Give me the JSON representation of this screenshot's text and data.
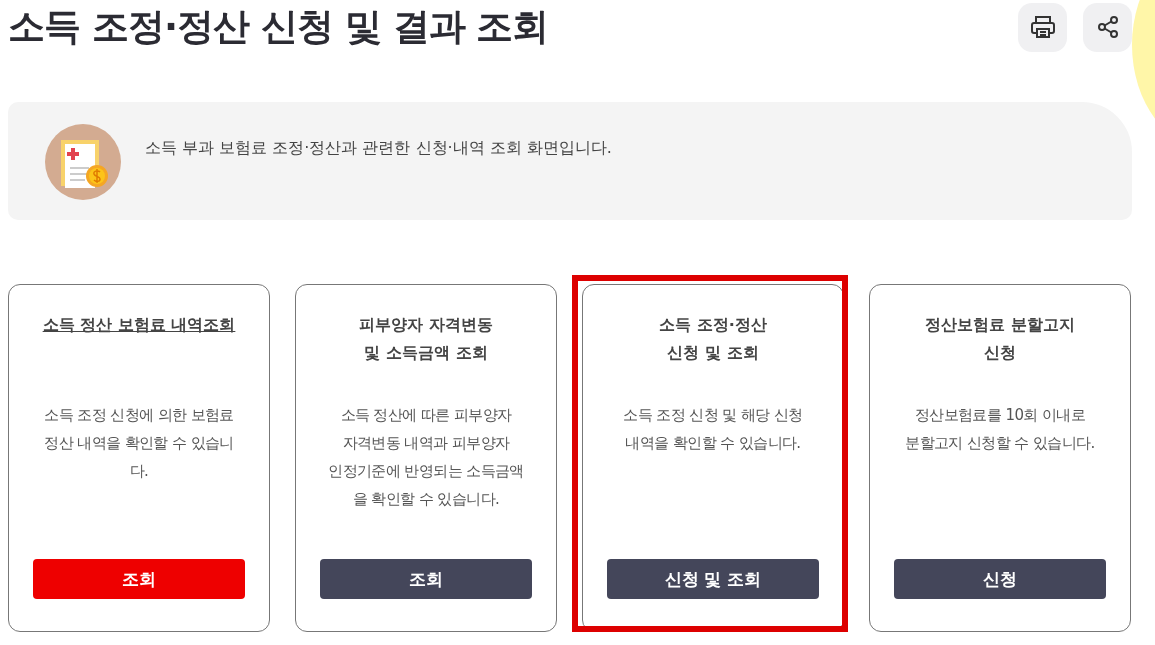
{
  "page_title": "소득 조정·정산 신청 및 결과 조회",
  "toolbar": [
    {
      "kind": "print"
    },
    {
      "kind": "share"
    }
  ],
  "intro": {
    "text": "소득 부과 보험료 조정·정산과 관련한 신청·내역 조회 화면입니다."
  },
  "cards": [
    {
      "title": "소득 정산 보험료 내역조회",
      "description": "소득 조정 신청에 의한 보험료\n정산 내역을 확인할 수 있습니\n다.",
      "button": "조회",
      "active": true,
      "highlighted": false
    },
    {
      "title": "피부양자 자격변동\n및 소득금액 조회",
      "description": "소득 정산에 따른 피부양자\n자격변동 내역과 피부양자\n인정기준에 반영되는 소득금액\n을 확인할 수 있습니다.",
      "button": "조회",
      "active": false,
      "highlighted": false
    },
    {
      "title": "소득 조정·정산\n신청 및 조회",
      "description": "소득 조정 신청 및 해당 신청\n내역을 확인할 수 있습니다.",
      "button": "신청 및 조회",
      "active": false,
      "highlighted": true
    },
    {
      "title": "정산보험료 분할고지\n신청",
      "description": "정산보험료를 10회 이내로\n분할고지 신청할 수 있습니다.",
      "button": "신청",
      "active": false,
      "highlighted": false
    }
  ]
}
